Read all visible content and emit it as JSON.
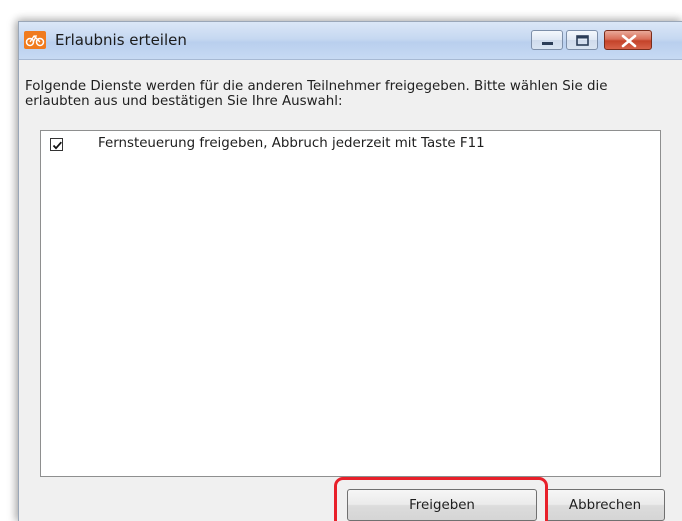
{
  "window": {
    "title": "Erlaubnis erteilen",
    "app_icon": "bicycle-link-icon"
  },
  "caption_buttons": {
    "minimize": "minimize-icon",
    "maximize": "maximize-icon",
    "close": "close-icon"
  },
  "dialog": {
    "instruction": "Folgende Dienste werden für die anderen Teilnehmer freigegeben. Bitte wählen Sie die erlaubten aus und bestätigen Sie Ihre Auswahl:",
    "services": [
      {
        "label": "Fernsteuerung freigeben, Abbruch jederzeit mit Taste F11",
        "checked": true
      }
    ]
  },
  "buttons": {
    "confirm_label": "Freigeben",
    "cancel_label": "Abbrechen"
  },
  "colors": {
    "highlight": "#e8202a",
    "app_icon": "#f07b1e",
    "close_button": "#c4432a"
  }
}
